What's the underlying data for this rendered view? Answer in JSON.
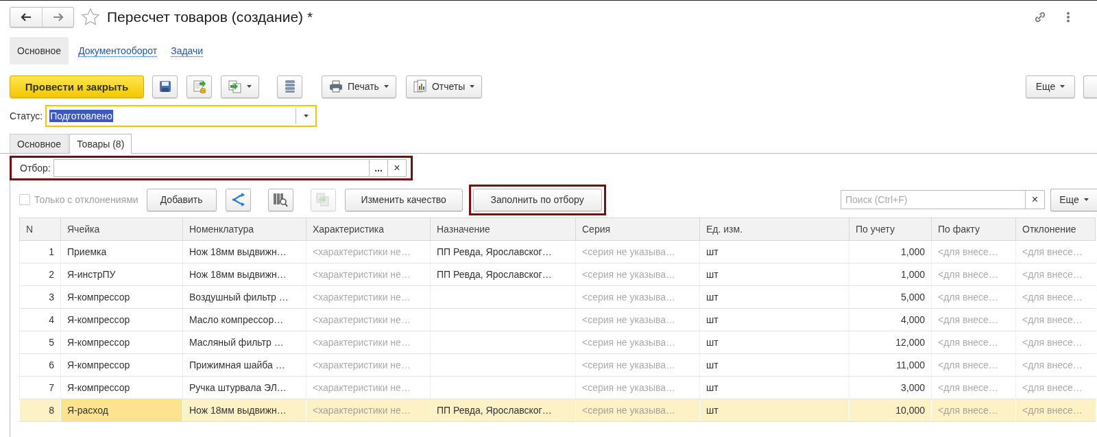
{
  "window": {
    "title": "Пересчет товаров (создание) *",
    "favorite": false
  },
  "nav_tabs": [
    {
      "label": "Основное",
      "selected": true
    },
    {
      "label": "Документооборот",
      "selected": false
    },
    {
      "label": "Задачи",
      "selected": false
    }
  ],
  "toolbar": {
    "buttons": [
      {
        "kind": "primary",
        "label": "Провести и закрыть"
      },
      {
        "kind": "save"
      },
      {
        "kind": "post"
      },
      {
        "kind": "copy",
        "dropdown": true
      },
      {
        "kind": "list"
      },
      {
        "kind": "print",
        "label": "Печать",
        "dropdown": true
      },
      {
        "kind": "reports",
        "label": "Отчеты",
        "dropdown": true
      }
    ],
    "more": "Еще"
  },
  "status": {
    "label": "Статус:",
    "value": "Подготовлено"
  },
  "tabs": [
    {
      "label": "Основное",
      "selected": false
    },
    {
      "label": "Товары (8)",
      "selected": true
    }
  ],
  "filter": {
    "label": "Отбор:",
    "select_button": "...",
    "clear_button": "×",
    "highlighted": true
  },
  "table_toolbar": {
    "only_deviations": {
      "label": "Только с отклонениями",
      "checked": false,
      "disabled": true
    },
    "add": "Добавить",
    "icon_buttons": [
      {
        "kind": "branch",
        "disabled": false
      },
      {
        "kind": "barcode",
        "disabled": false
      },
      {
        "kind": "transfer",
        "disabled": true
      }
    ],
    "change_quality": "Изменить качество",
    "fill_by_filter": {
      "label": "Заполнить по отбору",
      "highlighted": true
    },
    "search": {
      "placeholder": "Поиск (Ctrl+F)",
      "clear": "×"
    },
    "more": "Еще"
  },
  "table": {
    "columns": [
      {
        "label": "N",
        "muted": false,
        "current": false
      },
      {
        "label": "Ячейка",
        "muted": false,
        "current": true
      },
      {
        "label": "Номенклатура",
        "muted": false,
        "current": false
      },
      {
        "label": "Характеристика",
        "muted": true,
        "current": false
      },
      {
        "label": "Назначение",
        "muted": false,
        "current": false
      },
      {
        "label": "Серия",
        "muted": true,
        "current": false
      },
      {
        "label": "Ед. изм.",
        "muted": false,
        "current": false
      },
      {
        "label": "По учету",
        "muted": false,
        "current": false
      },
      {
        "label": "По факту",
        "muted": true,
        "current": false
      },
      {
        "label": "Отклонение",
        "muted": true,
        "current": false
      }
    ],
    "rows": [
      {
        "cells": [
          "1",
          "Приемка",
          "Нож 18мм выдвижн…",
          "<характеристики не…",
          "ПП Ревда, Ярославског…",
          "<серия не указыва…",
          "шт",
          "1,000",
          "<для внесе…",
          "<для внесе…"
        ],
        "selected": false
      },
      {
        "cells": [
          "2",
          "Я-инстрПУ",
          "Нож 18мм выдвижн…",
          "<характеристики не…",
          "ПП Ревда, Ярославског…",
          "<серия не указыва…",
          "шт",
          "1,000",
          "<для внесе…",
          "<для внесе…"
        ],
        "selected": false
      },
      {
        "cells": [
          "3",
          "Я-компрессор",
          "Воздушный фильтр …",
          "<характеристики не…",
          null,
          "<серия не указыва…",
          "шт",
          "5,000",
          "<для внесе…",
          "<для внесе…"
        ],
        "selected": false
      },
      {
        "cells": [
          "4",
          "Я-компрессор",
          "Масло компрессор…",
          "<характеристики не…",
          null,
          "<серия не указыва…",
          "шт",
          "4,000",
          "<для внесе…",
          "<для внесе…"
        ],
        "selected": false
      },
      {
        "cells": [
          "5",
          "Я-компрессор",
          "Масляный фильтр …",
          "<характеристики не…",
          null,
          "<серия не указыва…",
          "шт",
          "12,000",
          "<для внесе…",
          "<для внесе…"
        ],
        "selected": false
      },
      {
        "cells": [
          "6",
          "Я-компрессор",
          "Прижимная шайба …",
          "<характеристики не…",
          null,
          "<серия не указыва…",
          "шт",
          "11,000",
          "<для внесе…",
          "<для внесе…"
        ],
        "selected": false
      },
      {
        "cells": [
          "7",
          "Я-компрессор",
          "Ручка штурвала ЭЛ…",
          "<характеристики не…",
          null,
          "<серия не указыва…",
          "шт",
          "3,000",
          "<для внесе…",
          "<для внесе…"
        ],
        "selected": false
      },
      {
        "cells": [
          "8",
          "Я-расход",
          "Нож 18мм выдвижн…",
          "<характеристики не…",
          "ПП Ревда, Ярославског…",
          "<серия не указыва…",
          "шт",
          "10,000",
          "<для внесе…",
          "<для внесе…"
        ],
        "selected": true
      }
    ]
  }
}
